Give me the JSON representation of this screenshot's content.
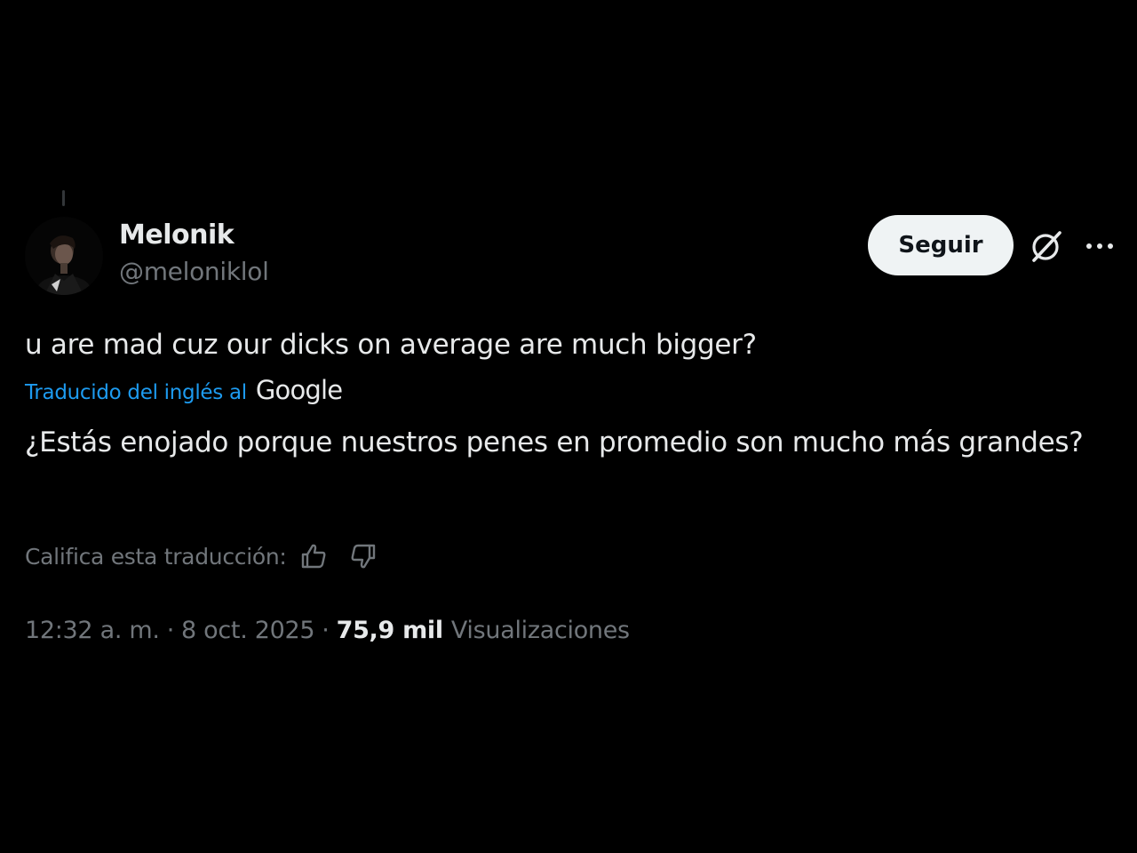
{
  "colors": {
    "background": "#000000",
    "primary_text": "#e7e9ea",
    "secondary_text": "#71767b",
    "link": "#1d9bf0",
    "follow_button_bg": "#eff3f4",
    "follow_button_text": "#0f1419"
  },
  "author": {
    "display_name": "Melonik",
    "handle": "@meloniklol",
    "avatar_icon": "profile-photo"
  },
  "actions": {
    "follow_label": "Seguir",
    "grok_icon": "grok-icon",
    "more_icon": "more-dots-icon"
  },
  "tweet": {
    "text": "u are mad cuz our dicks on average are much bigger?"
  },
  "translation": {
    "label": "Traducido del inglés al",
    "provider": "Google",
    "text": "¿Estás enojado porque nuestros penes en promedio son mucho más grandes?",
    "rate_label": "Califica esta traducción:",
    "thumbs_up_icon": "thumbs-up-icon",
    "thumbs_down_icon": "thumbs-down-icon"
  },
  "meta": {
    "time": "12:32 a. m.",
    "separator": "·",
    "date": "8 oct. 2025",
    "views_count": "75,9 mil",
    "views_label": "Visualizaciones"
  }
}
